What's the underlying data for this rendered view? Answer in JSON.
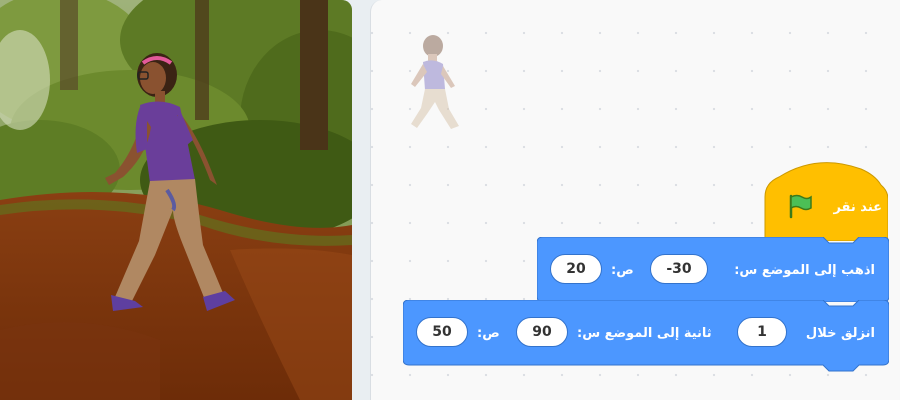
{
  "colors": {
    "events_block": "#ffbf00",
    "motion_block": "#4c97ff",
    "motion_border": "#3373cc",
    "workspace_bg": "#f9f9f9"
  },
  "script": {
    "hat_label": "عند نقر",
    "hat_icon": "green-flag-icon",
    "goto": {
      "label_prefix": "اذهب إلى الموضع س:",
      "x_value": "-30",
      "y_label": "ص:",
      "y_value": "20"
    },
    "glide": {
      "label_prefix": "انزلق خلال",
      "secs_value": "1",
      "label_mid": "ثانية إلى الموضع س:",
      "x_value": "90",
      "y_label": "ص:",
      "y_value": "50"
    }
  }
}
